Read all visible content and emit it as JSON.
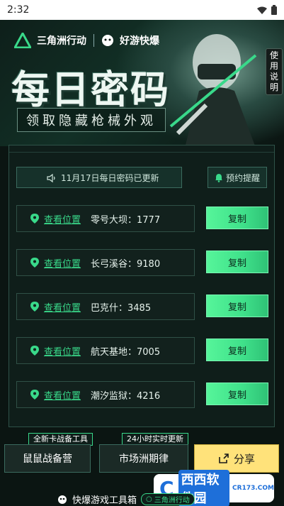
{
  "status_bar": {
    "time": "2:32"
  },
  "header": {
    "brand_left": "三角洲行动",
    "brand_right": "好游快爆",
    "title": "每日密码",
    "subtitle": "领取隐藏枪械外观",
    "help_label_lines": [
      "使",
      "用",
      "说",
      "明"
    ]
  },
  "notice": {
    "update_text": "11月17日每日密码已更新",
    "remind_label": "预约提醒"
  },
  "codes": [
    {
      "location_label": "查看位置",
      "text": "零号大坝：1777",
      "copy_label": "复制"
    },
    {
      "location_label": "查看位置",
      "text": "长弓溪谷：9180",
      "copy_label": "复制"
    },
    {
      "location_label": "查看位置",
      "text": "巴克什：3485",
      "copy_label": "复制"
    },
    {
      "location_label": "查看位置",
      "text": "航天基地：7005",
      "copy_label": "复制"
    },
    {
      "location_label": "查看位置",
      "text": "潮汐监狱：4216",
      "copy_label": "复制"
    }
  ],
  "bottom": {
    "tag1": "全新卡战备工具",
    "btn1": "鼠鼠战备营",
    "tag2": "24小时实时更新",
    "btn2": "市场洲期律",
    "share": "分享"
  },
  "footer": {
    "label": "快爆游戏工具箱",
    "pill": "三角洲行动"
  },
  "watermark": {
    "logo": "C",
    "text": "西西软件园",
    "url": "CR173.COM"
  },
  "colors": {
    "accent": "#39d98a",
    "copy": "#56f59a",
    "share": "#ffe27a"
  }
}
